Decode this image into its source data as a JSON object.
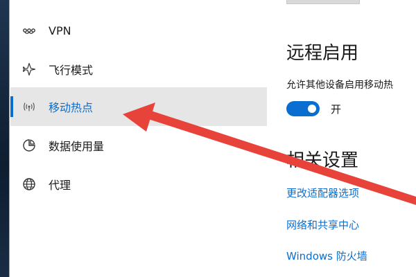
{
  "sidebar": {
    "items": [
      {
        "label": "VPN",
        "icon": "vpn-icon"
      },
      {
        "label": "飞行模式",
        "icon": "airplane-icon"
      },
      {
        "label": "移动热点",
        "icon": "hotspot-icon",
        "selected": true
      },
      {
        "label": "数据使用量",
        "icon": "data-usage-icon"
      },
      {
        "label": "代理",
        "icon": "globe-icon"
      }
    ]
  },
  "remote": {
    "heading": "远程启用",
    "description": "允许其他设备启用移动热",
    "toggle_state": "开",
    "toggle_on": true
  },
  "related": {
    "heading": "相关设置",
    "links": [
      "更改适配器选项",
      "网络和共享中心",
      "Windows 防火墙"
    ]
  },
  "colors": {
    "accent": "#0a6ed1",
    "selected_bg": "#e6e6e6",
    "annotation_arrow": "#e8433b"
  }
}
